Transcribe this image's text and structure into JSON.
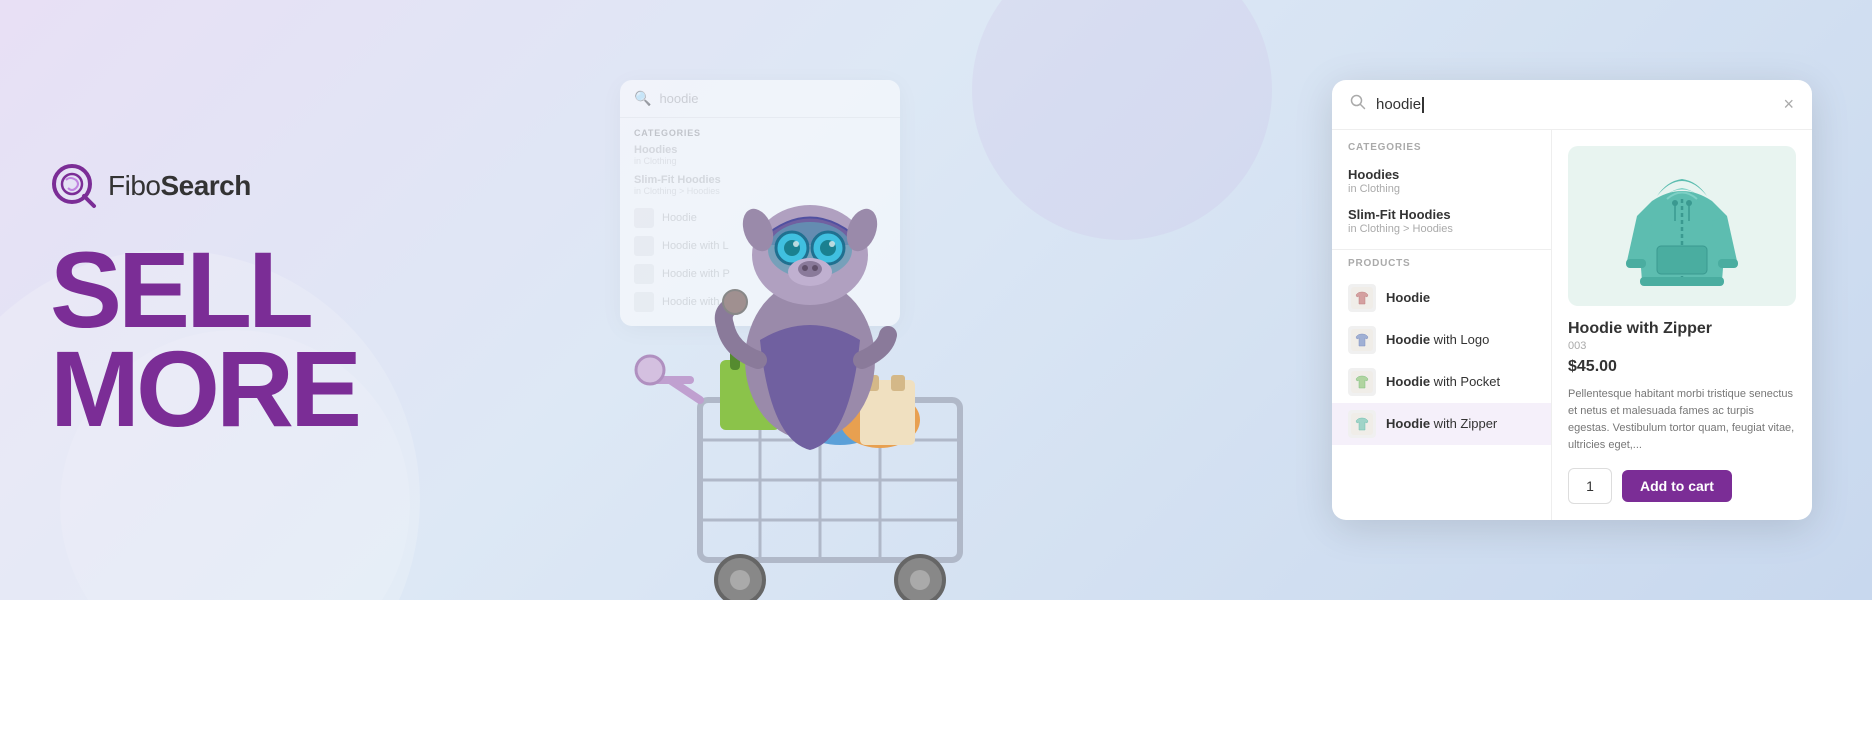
{
  "brand": {
    "name_regular": "Fibo",
    "name_bold": "Search",
    "logo_alt": "FiboSearch logo"
  },
  "hero": {
    "line1": "SELL",
    "line2": "MORE"
  },
  "bg_panel": {
    "search_value": "hoodie",
    "categories_label": "CATEGORIES",
    "categories": [
      {
        "name": "Hoodies",
        "path": "in Clothing"
      },
      {
        "name": "Slim-Fit Hoodies",
        "path": "in Clothing > Hoodies"
      }
    ],
    "products": [
      "Hoodie",
      "Hoodie with L",
      "Hoodie with P",
      "Hoodie with Z"
    ]
  },
  "main_panel": {
    "search_value": "hoodie",
    "close_btn": "×",
    "categories_label": "CATEGORIES",
    "categories": [
      {
        "name": "Hoodies",
        "in_label": "in Clothing",
        "highlight": "Hoodie"
      },
      {
        "name": "Slim-Fit Hoodies",
        "in_label": "in Clothing > Hoodies",
        "highlight": "Hoodie"
      }
    ],
    "products_label": "PRODUCTS",
    "products": [
      {
        "name": "Hoodie",
        "highlight": "Hoodie",
        "active": false
      },
      {
        "name": "Hoodie with Logo",
        "highlight": "Hoodie",
        "active": false
      },
      {
        "name": "Hoodie with Pocket",
        "highlight": "Hoodie",
        "active": false
      },
      {
        "name": "Hoodie with Zipper",
        "highlight": "Hoodie",
        "active": true
      }
    ],
    "detail": {
      "name": "Hoodie with Zipper",
      "sku": "003",
      "price": "$45.00",
      "description": "Pellentesque habitant morbi tristique senectus et netus et malesuada fames ac turpis egestas. Vestibulum tortor quam, feugiat vitae, ultricies eget,...",
      "qty": "1",
      "add_to_cart": "Add to cart"
    }
  }
}
